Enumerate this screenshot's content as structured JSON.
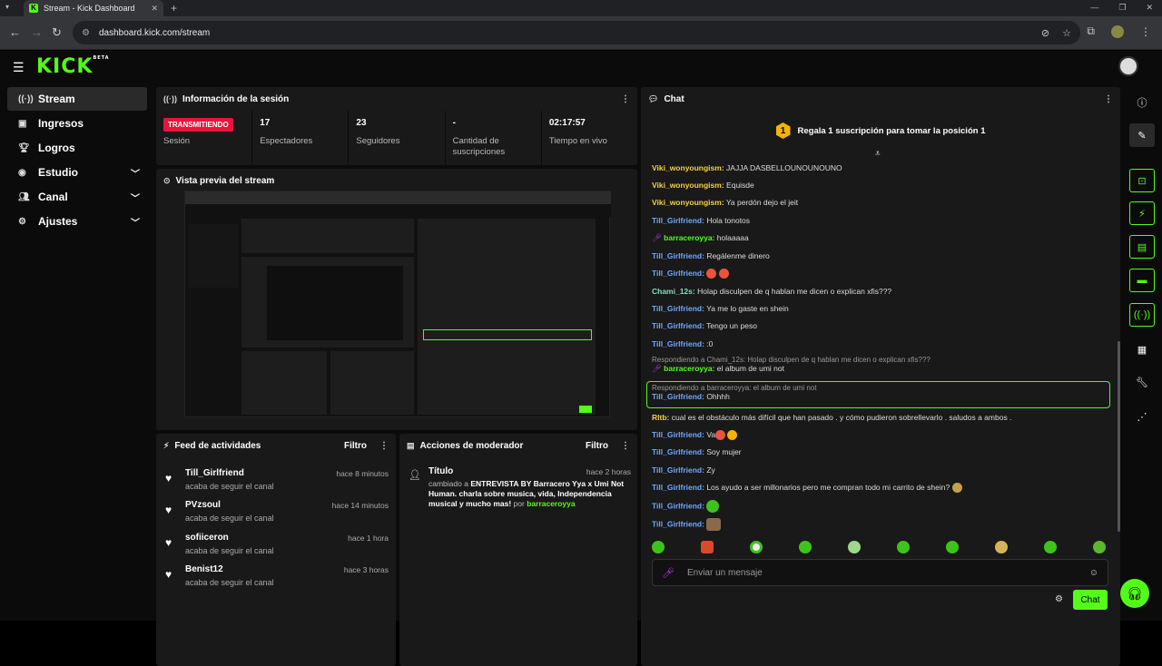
{
  "browser": {
    "tab_title": "Stream - Kick Dashboard",
    "url": "dashboard.kick.com/stream",
    "new_tab": "+",
    "tab_close": "✕"
  },
  "app": {
    "logo": "KICK",
    "logo_tag": "BETA"
  },
  "sidebar": {
    "items": [
      {
        "label": "Stream",
        "icon": "broadcast-icon"
      },
      {
        "label": "Ingresos",
        "icon": "wallet-icon"
      },
      {
        "label": "Logros",
        "icon": "trophy-icon"
      },
      {
        "label": "Estudio",
        "icon": "camera-icon"
      },
      {
        "label": "Canal",
        "icon": "users-icon"
      },
      {
        "label": "Ajustes",
        "icon": "gear-icon"
      }
    ]
  },
  "session": {
    "title": "Información de la sesión",
    "status_badge": "TRANSMITIENDO",
    "status_label": "Sesión",
    "viewers_value": "17",
    "viewers_label": "Espectadores",
    "followers_value": "23",
    "followers_label": "Seguidores",
    "subs_value": "-",
    "subs_label": "Cantidad de suscripciones",
    "uptime_value": "02:17:57",
    "uptime_label": "Tiempo en vivo"
  },
  "preview": {
    "title": "Vista previa del stream"
  },
  "feed": {
    "title": "Feed de actividades",
    "filter": "Filtro",
    "items": [
      {
        "name": "Till_Girlfriend",
        "sub": "acaba de seguir el canal",
        "time": "hace 8 minutos"
      },
      {
        "name": "PVzsoul",
        "sub": "acaba de seguir el canal",
        "time": "hace 14 minutos"
      },
      {
        "name": "sofiiceron",
        "sub": "acaba de seguir el canal",
        "time": "hace 1 hora"
      },
      {
        "name": "Benist12",
        "sub": "acaba de seguir el canal",
        "time": "hace 3 horas"
      }
    ]
  },
  "mod": {
    "title": "Acciones de moderador",
    "filter": "Filtro",
    "item_title": "Título",
    "item_time": "hace 2 horas",
    "item_prefix": "cambiado a",
    "item_text": "ENTREVISTA BY Barracero Yya x Umi Not Human. charla sobre musica, vida, Independencia musical y mucho mas!",
    "item_by": "por",
    "item_user": "barraceroyya"
  },
  "chat": {
    "title": "Chat",
    "pinned": "Regala 1 suscripción para tomar la posición 1",
    "pinned_rank": "1",
    "placeholder": "Enviar un mensaje",
    "send": "Chat",
    "messages": [
      {
        "user": "Viki_wonyoungism:",
        "text": "JAJJA DASBELLOUNOUNOUNO",
        "color": "#f5d142"
      },
      {
        "user": "Viki_wonyoungism:",
        "text": "Equisde",
        "color": "#f5d142"
      },
      {
        "user": "Viki_wonyoungism:",
        "text": "Ya perdón dejo el jeit",
        "color": "#f5d142"
      },
      {
        "user": "Till_Girlfriend:",
        "text": "Hola tonotos",
        "color": "#6fa8ff"
      },
      {
        "user": "barraceroyya:",
        "text": "holaaaaa",
        "color": "#53fc18"
      },
      {
        "user": "Till_Girlfriend:",
        "text": "Regálenme dinero",
        "color": "#6fa8ff"
      },
      {
        "user": "Till_Girlfriend:",
        "text": "",
        "color": "#6fa8ff"
      },
      {
        "user": "Chami_12s:",
        "text": "Holap disculpen de q hablan me dicen o explican xfis???",
        "color": "#7ce0c0"
      },
      {
        "user": "Till_Girlfriend:",
        "text": "Ya me lo gaste en shein",
        "color": "#6fa8ff"
      },
      {
        "user": "Till_Girlfriend:",
        "text": "Tengo un peso",
        "color": "#6fa8ff"
      },
      {
        "user": "Till_Girlfriend:",
        "text": ":0",
        "color": "#6fa8ff"
      }
    ],
    "reply1_context": "Respondiendo a Chami_12s: Holap disculpen de q hablan me dicen o explican xfis???",
    "reply1_user": "barraceroyya:",
    "reply1_text": "el album de umi not",
    "reply2_context": "Respondiendo a barraceroyya: el album de umi not",
    "reply2_user": "Till_Girlfriend:",
    "reply2_text": "Ohhhh",
    "messages2": [
      {
        "user": "Rltb:",
        "text": "cual es el obstáculo más difícil que han pasado . y cómo pudieron sobrellevarlo . saludos a ambos .",
        "color": "#f5d142"
      },
      {
        "user": "Till_Girlfriend:",
        "text": "Va",
        "color": "#6fa8ff"
      },
      {
        "user": "Till_Girlfriend:",
        "text": "Soy mujer",
        "color": "#6fa8ff"
      },
      {
        "user": "Till_Girlfriend:",
        "text": "Zy",
        "color": "#6fa8ff"
      },
      {
        "user": "Till_Girlfriend:",
        "text": "Los ayudo a ser millonarios pero me compran todo mi carrito de shein?",
        "color": "#6fa8ff"
      },
      {
        "user": "Till_Girlfriend:",
        "text": "",
        "color": "#6fa8ff"
      },
      {
        "user": "Till_Girlfriend:",
        "text": "",
        "color": "#6fa8ff"
      }
    ]
  },
  "colors": {
    "accent": "#53fc18",
    "live": "#e8153b",
    "panel": "#191919"
  }
}
